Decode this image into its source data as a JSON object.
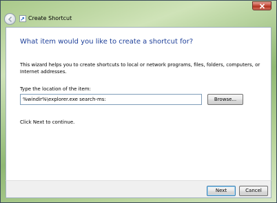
{
  "window": {
    "title": "Create Shortcut",
    "icons": {
      "back": "back-arrow-icon",
      "app": "shortcut-icon",
      "close": "close-x-icon"
    }
  },
  "main": {
    "heading": "What item would you like to create a shortcut for?",
    "description": "This wizard helps you to create shortcuts to local or network programs, files, folders, computers, or Internet addresses.",
    "location_label": "Type the location of the item:",
    "location_value": "%windir%\\explorer.exe search-ms:",
    "browse_label": "Browse...",
    "continue_text": "Click Next to continue."
  },
  "footer": {
    "next_label": "Next",
    "cancel_label": "Cancel"
  },
  "colors": {
    "heading": "#1d3f99",
    "close_button": "#c75040",
    "frame_glass": "#a9c98a"
  }
}
